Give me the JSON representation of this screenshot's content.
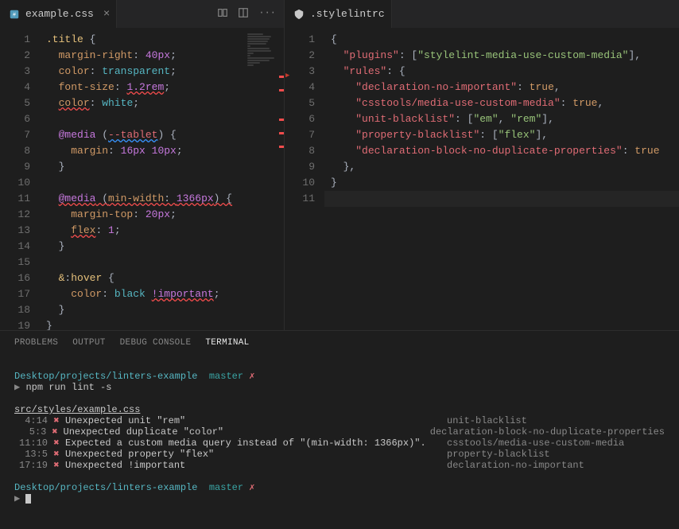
{
  "leftTab": {
    "name": "example.css"
  },
  "rightTab": {
    "name": ".stylelintrc"
  },
  "leftLines": 19,
  "rightLines": 11,
  "cssCode": [
    {
      "ind": 0,
      "tokens": [
        {
          "t": "c-sel",
          "v": ".title"
        },
        {
          "t": "c-punc",
          "v": " {"
        }
      ]
    },
    {
      "ind": 1,
      "tokens": [
        {
          "t": "c-prop",
          "v": "margin-right"
        },
        {
          "t": "c-punc",
          "v": ": "
        },
        {
          "t": "c-num",
          "v": "40px"
        },
        {
          "t": "c-punc",
          "v": ";"
        }
      ]
    },
    {
      "ind": 1,
      "tokens": [
        {
          "t": "c-prop",
          "v": "color"
        },
        {
          "t": "c-punc",
          "v": ": "
        },
        {
          "t": "c-val",
          "v": "transparent"
        },
        {
          "t": "c-punc",
          "v": ";"
        }
      ]
    },
    {
      "ind": 1,
      "tokens": [
        {
          "t": "c-prop",
          "v": "font-size"
        },
        {
          "t": "c-punc",
          "v": ": "
        },
        {
          "t": "c-num wavy-red",
          "v": "1.2rem"
        },
        {
          "t": "c-punc",
          "v": ";"
        }
      ]
    },
    {
      "ind": 1,
      "tokens": [
        {
          "t": "c-prop wavy-red",
          "v": "color"
        },
        {
          "t": "c-punc",
          "v": ": "
        },
        {
          "t": "c-val",
          "v": "white"
        },
        {
          "t": "c-punc",
          "v": ";"
        }
      ]
    },
    {
      "ind": 0,
      "tokens": []
    },
    {
      "ind": 1,
      "tokens": [
        {
          "t": "c-key",
          "v": "@media"
        },
        {
          "t": "c-punc",
          "v": " ("
        },
        {
          "t": "c-var wavy-blue",
          "v": "--tablet"
        },
        {
          "t": "c-punc",
          "v": ") {"
        }
      ]
    },
    {
      "ind": 2,
      "tokens": [
        {
          "t": "c-prop",
          "v": "margin"
        },
        {
          "t": "c-punc",
          "v": ": "
        },
        {
          "t": "c-num",
          "v": "16px 10px"
        },
        {
          "t": "c-punc",
          "v": ";"
        }
      ]
    },
    {
      "ind": 1,
      "tokens": [
        {
          "t": "c-punc",
          "v": "}"
        }
      ]
    },
    {
      "ind": 0,
      "tokens": []
    },
    {
      "ind": 1,
      "tokens": [
        {
          "t": "c-key",
          "v": "@media"
        },
        {
          "t": "c-punc",
          "v": " ("
        },
        {
          "t": "c-prop",
          "v": "min-width"
        },
        {
          "t": "c-punc",
          "v": ": "
        },
        {
          "t": "c-num",
          "v": "1366px"
        },
        {
          "t": "c-punc",
          "v": ") {"
        }
      ],
      "wavyAll": true
    },
    {
      "ind": 2,
      "tokens": [
        {
          "t": "c-prop",
          "v": "margin-top"
        },
        {
          "t": "c-punc",
          "v": ": "
        },
        {
          "t": "c-num",
          "v": "20px"
        },
        {
          "t": "c-punc",
          "v": ";"
        }
      ]
    },
    {
      "ind": 2,
      "tokens": [
        {
          "t": "c-prop wavy-red",
          "v": "flex"
        },
        {
          "t": "c-punc",
          "v": ": "
        },
        {
          "t": "c-num",
          "v": "1"
        },
        {
          "t": "c-punc",
          "v": ";"
        }
      ]
    },
    {
      "ind": 1,
      "tokens": [
        {
          "t": "c-punc",
          "v": "}"
        }
      ]
    },
    {
      "ind": 0,
      "tokens": []
    },
    {
      "ind": 1,
      "tokens": [
        {
          "t": "c-sel",
          "v": "&"
        },
        {
          "t": "c-punc",
          "v": ":"
        },
        {
          "t": "c-sel",
          "v": "hover"
        },
        {
          "t": "c-punc",
          "v": " {"
        }
      ]
    },
    {
      "ind": 2,
      "tokens": [
        {
          "t": "c-prop",
          "v": "color"
        },
        {
          "t": "c-punc",
          "v": ": "
        },
        {
          "t": "c-val",
          "v": "black"
        },
        {
          "t": "c-punc",
          "v": " "
        },
        {
          "t": "c-imp wavy-red",
          "v": "!important"
        },
        {
          "t": "c-punc",
          "v": ";"
        }
      ]
    },
    {
      "ind": 1,
      "tokens": [
        {
          "t": "c-punc",
          "v": "}"
        }
      ]
    },
    {
      "ind": 0,
      "tokens": [
        {
          "t": "c-punc",
          "v": "}"
        }
      ]
    }
  ],
  "jsonCode": [
    {
      "ind": 0,
      "text": "{"
    },
    {
      "ind": 1,
      "parts": [
        {
          "t": "c-jprop",
          "v": "\"plugins\""
        },
        {
          "t": "c-punc",
          "v": ": ["
        },
        {
          "t": "c-str",
          "v": "\"stylelint-media-use-custom-media\""
        },
        {
          "t": "c-punc",
          "v": "],"
        }
      ],
      "marker": "blue"
    },
    {
      "ind": 1,
      "parts": [
        {
          "t": "c-jprop",
          "v": "\"rules\""
        },
        {
          "t": "c-punc",
          "v": ": {"
        }
      ],
      "arrow": true
    },
    {
      "ind": 2,
      "parts": [
        {
          "t": "c-jprop",
          "v": "\"declaration-no-important\""
        },
        {
          "t": "c-punc",
          "v": ": "
        },
        {
          "t": "c-true",
          "v": "true"
        },
        {
          "t": "c-punc",
          "v": ","
        }
      ],
      "marker": "blue"
    },
    {
      "ind": 2,
      "parts": [
        {
          "t": "c-jprop",
          "v": "\"csstools/media-use-custom-media\""
        },
        {
          "t": "c-punc",
          "v": ": "
        },
        {
          "t": "c-true",
          "v": "true"
        },
        {
          "t": "c-punc",
          "v": ","
        }
      ],
      "marker": "blue"
    },
    {
      "ind": 2,
      "parts": [
        {
          "t": "c-jprop",
          "v": "\"unit-blacklist\""
        },
        {
          "t": "c-punc",
          "v": ": ["
        },
        {
          "t": "c-str",
          "v": "\"em\""
        },
        {
          "t": "c-punc",
          "v": ", "
        },
        {
          "t": "c-str",
          "v": "\"rem\""
        },
        {
          "t": "c-punc",
          "v": "],"
        }
      ]
    },
    {
      "ind": 2,
      "parts": [
        {
          "t": "c-jprop",
          "v": "\"property-blacklist\""
        },
        {
          "t": "c-punc",
          "v": ": ["
        },
        {
          "t": "c-str",
          "v": "\"flex\""
        },
        {
          "t": "c-punc",
          "v": "],"
        }
      ],
      "marker": "green"
    },
    {
      "ind": 2,
      "parts": [
        {
          "t": "c-jprop",
          "v": "\"declaration-block-no-duplicate-properties\""
        },
        {
          "t": "c-punc",
          "v": ": "
        },
        {
          "t": "c-true",
          "v": "true"
        }
      ],
      "marker": "green"
    },
    {
      "ind": 1,
      "text": "},"
    },
    {
      "ind": 0,
      "text": "}"
    },
    {
      "ind": 0,
      "text": "",
      "cursor": true
    }
  ],
  "panelTabs": [
    "PROBLEMS",
    "OUTPUT",
    "DEBUG CONSOLE",
    "TERMINAL"
  ],
  "activePanelTab": 3,
  "terminal": {
    "prompt1": {
      "path": "Desktop/projects/linters-example",
      "branch": "master",
      "dirty": "✗"
    },
    "cmd1": "npm run lint -s",
    "file": "src/styles/example.css",
    "errors": [
      {
        "pos": "4:14",
        "msg": "Unexpected unit \"rem\"",
        "rule": "unit-blacklist"
      },
      {
        "pos": "5:3",
        "msg": "Unexpected duplicate \"color\"",
        "rule": "declaration-block-no-duplicate-properties"
      },
      {
        "pos": "11:10",
        "msg": "Expected a custom media query instead of \"(min-width: 1366px)\".",
        "rule": "csstools/media-use-custom-media"
      },
      {
        "pos": "13:5",
        "msg": "Unexpected property \"flex\"",
        "rule": "property-blacklist"
      },
      {
        "pos": "17:19",
        "msg": "Unexpected !important",
        "rule": "declaration-no-important"
      }
    ],
    "prompt2": {
      "path": "Desktop/projects/linters-example",
      "branch": "master",
      "dirty": "✗"
    }
  }
}
